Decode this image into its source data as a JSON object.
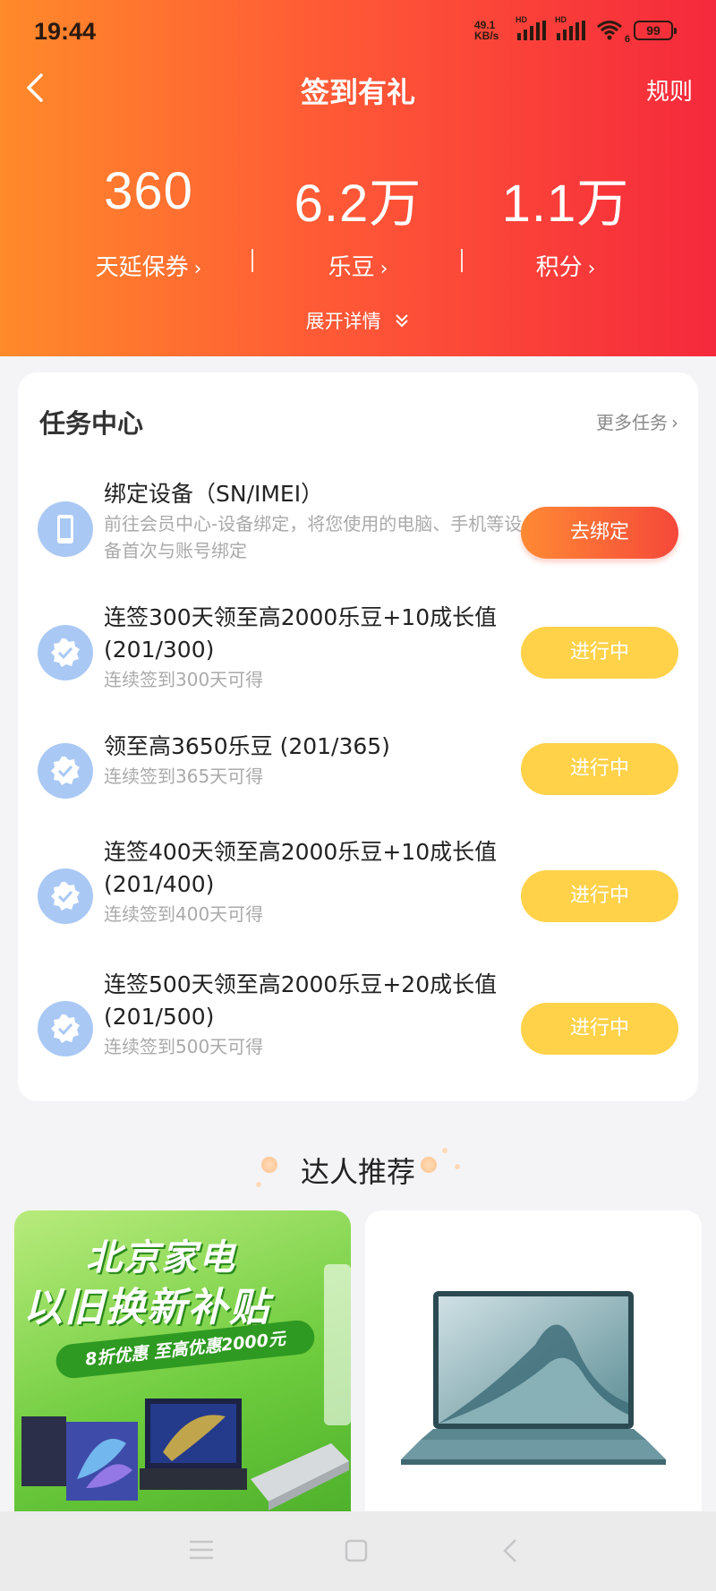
{
  "status_bar": {
    "time": "19:44",
    "net_speed_value": "49.1",
    "net_speed_unit": "KB/s",
    "signal_1_tag": "HD",
    "signal_2_tag": "HD",
    "wifi_tag": "6",
    "battery": "99"
  },
  "header": {
    "title": "签到有礼",
    "rules": "规则"
  },
  "stats": [
    {
      "value": "360",
      "label": "天延保券"
    },
    {
      "value": "6.2万",
      "label": "乐豆"
    },
    {
      "value": "1.1万",
      "label": "积分"
    }
  ],
  "chevron": "›",
  "expand_label": "展开详情",
  "task_center": {
    "title": "任务中心",
    "more": "更多任务",
    "tasks": [
      {
        "title": "绑定设备（SN/IMEI）",
        "desc": "前往会员中心-设备绑定，将您使用的电脑、手机等设备首次与账号绑定",
        "button": "去绑定",
        "icon": "phone-icon"
      },
      {
        "title": "连签300天领至高2000乐豆+10成长值 (201/300)",
        "desc": "连续签到300天可得",
        "button": "进行中",
        "icon": "badge-check-icon"
      },
      {
        "title": "领至高3650乐豆 (201/365)",
        "desc": "连续签到365天可得",
        "button": "进行中",
        "icon": "badge-check-icon"
      },
      {
        "title": "连签400天领至高2000乐豆+10成长值 (201/400)",
        "desc": "连续签到400天可得",
        "button": "进行中",
        "icon": "badge-check-icon"
      },
      {
        "title": "连签500天领至高2000乐豆+20成长值 (201/500)",
        "desc": "连续签到500天可得",
        "button": "进行中",
        "icon": "badge-check-icon"
      }
    ]
  },
  "recommend": {
    "title": "达人推荐",
    "promo": {
      "line1": "北京家电",
      "line2": "以旧换新补贴",
      "strip": "8折优惠 至高优惠2000元"
    }
  },
  "colors": {
    "header_start": "#ff8a2a",
    "header_end": "#f5293c",
    "bind_button": "#f5483a",
    "progress_button": "#ffd24a",
    "task_icon_bg": "#a9c8f4"
  }
}
